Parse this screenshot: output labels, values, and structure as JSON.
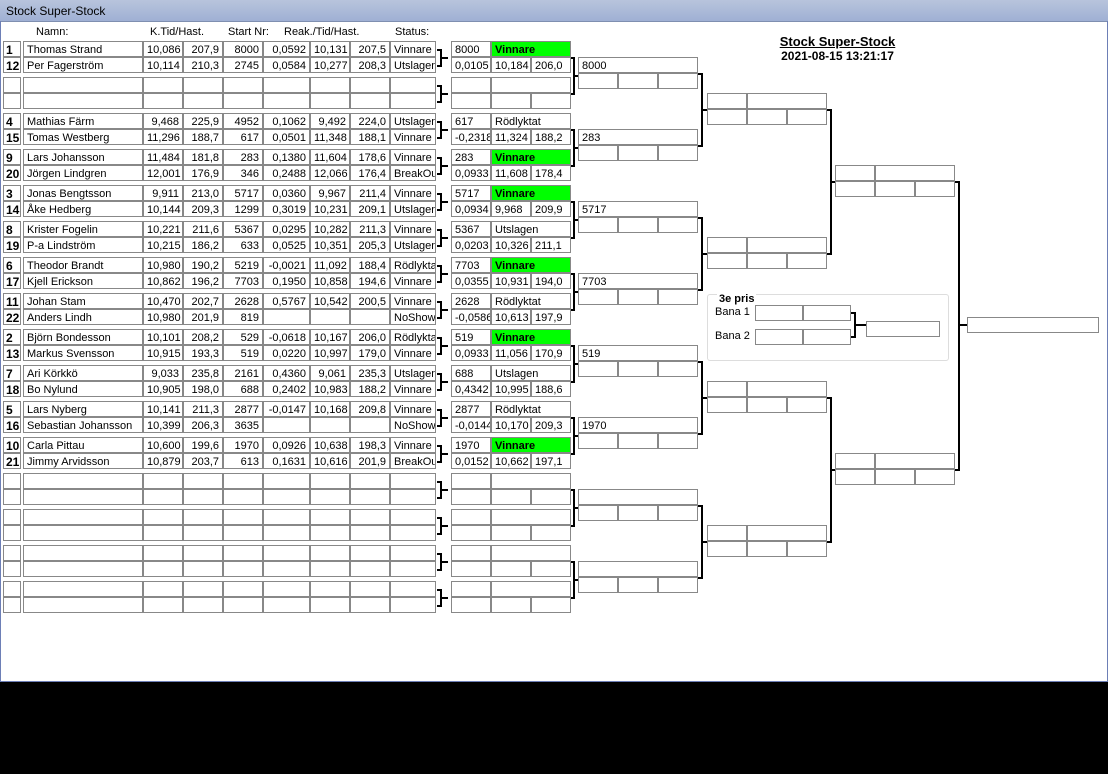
{
  "window_title": "Stock Super-Stock",
  "headers": {
    "name": "Namn:",
    "ktid": "K.Tid/Hast.",
    "start": "Start Nr:",
    "reak": "Reak./Tid/Hast.",
    "status": "Status:"
  },
  "title": "Stock Super-Stock",
  "datetime": "2021-08-15 13:21:17",
  "third_place": {
    "title": "3e pris",
    "lane1": "Bana 1",
    "lane2": "Bana 2"
  },
  "rows": [
    {
      "seed": "1",
      "name": "Thomas Strand",
      "ktid": "10,086",
      "hast": "207,9",
      "start": "8000",
      "reak": "0,0592",
      "tid": "10,131",
      "hast2": "207,5",
      "status": "Vinnare"
    },
    {
      "seed": "12",
      "name": "Per  Fagerström",
      "ktid": "10,114",
      "hast": "210,3",
      "start": "2745",
      "reak": "0,0584",
      "tid": "10,277",
      "hast2": "208,3",
      "status": "Utslagen"
    },
    {
      "seed": "",
      "name": "",
      "ktid": "",
      "hast": "",
      "start": "",
      "reak": "",
      "tid": "",
      "hast2": "",
      "status": ""
    },
    {
      "seed": "",
      "name": "",
      "ktid": "",
      "hast": "",
      "start": "",
      "reak": "",
      "tid": "",
      "hast2": "",
      "status": ""
    },
    {
      "seed": "4",
      "name": "Mathias Färm",
      "ktid": "9,468",
      "hast": "225,9",
      "start": "4952",
      "reak": "0,1062",
      "tid": "9,492",
      "hast2": "224,0",
      "status": "Utslagen"
    },
    {
      "seed": "15",
      "name": "Tomas Westberg",
      "ktid": "11,296",
      "hast": "188,7",
      "start": "617",
      "reak": "0,0501",
      "tid": "11,348",
      "hast2": "188,1",
      "status": "Vinnare"
    },
    {
      "seed": "9",
      "name": "Lars Johansson",
      "ktid": "11,484",
      "hast": "181,8",
      "start": "283",
      "reak": "0,1380",
      "tid": "11,604",
      "hast2": "178,6",
      "status": "Vinnare"
    },
    {
      "seed": "20",
      "name": "Jörgen Lindgren",
      "ktid": "12,001",
      "hast": "176,9",
      "start": "346",
      "reak": "0,2488",
      "tid": "12,066",
      "hast2": "176,4",
      "status": "BreakOut"
    },
    {
      "seed": "3",
      "name": "Jonas Bengtsson",
      "ktid": "9,911",
      "hast": "213,0",
      "start": "5717",
      "reak": "0,0360",
      "tid": "9,967",
      "hast2": "211,4",
      "status": "Vinnare"
    },
    {
      "seed": "14",
      "name": "Åke Hedberg",
      "ktid": "10,144",
      "hast": "209,3",
      "start": "1299",
      "reak": "0,3019",
      "tid": "10,231",
      "hast2": "209,1",
      "status": "Utslagen"
    },
    {
      "seed": "8",
      "name": "Krister Fogelin",
      "ktid": "10,221",
      "hast": "211,6",
      "start": "5367",
      "reak": "0,0295",
      "tid": "10,282",
      "hast2": "211,3",
      "status": "Vinnare"
    },
    {
      "seed": "19",
      "name": "P-a Lindström",
      "ktid": "10,215",
      "hast": "186,2",
      "start": "633",
      "reak": "0,0525",
      "tid": "10,351",
      "hast2": "205,3",
      "status": "Utslagen"
    },
    {
      "seed": "6",
      "name": "Theodor Brandt",
      "ktid": "10,980",
      "hast": "190,2",
      "start": "5219",
      "reak": "-0,0021",
      "tid": "11,092",
      "hast2": "188,4",
      "status": "Rödlyktat"
    },
    {
      "seed": "17",
      "name": "Kjell Erickson",
      "ktid": "10,862",
      "hast": "196,2",
      "start": "7703",
      "reak": "0,1950",
      "tid": "10,858",
      "hast2": "194,6",
      "status": "Vinnare"
    },
    {
      "seed": "11",
      "name": "Johan Stam",
      "ktid": "10,470",
      "hast": "202,7",
      "start": "2628",
      "reak": "0,5767",
      "tid": "10,542",
      "hast2": "200,5",
      "status": "Vinnare"
    },
    {
      "seed": "22",
      "name": "Anders Lindh",
      "ktid": "10,980",
      "hast": "201,9",
      "start": "819",
      "reak": "",
      "tid": "",
      "hast2": "",
      "status": "NoShow"
    },
    {
      "seed": "2",
      "name": "Björn Bondesson",
      "ktid": "10,101",
      "hast": "208,2",
      "start": "529",
      "reak": "-0,0618",
      "tid": "10,167",
      "hast2": "206,0",
      "status": "Rödlyktat"
    },
    {
      "seed": "13",
      "name": "Markus Svensson",
      "ktid": "10,915",
      "hast": "193,3",
      "start": "519",
      "reak": "0,0220",
      "tid": "10,997",
      "hast2": "179,0",
      "status": "Vinnare"
    },
    {
      "seed": "7",
      "name": "Ari Körkkö",
      "ktid": "9,033",
      "hast": "235,8",
      "start": "2161",
      "reak": "0,4360",
      "tid": "9,061",
      "hast2": "235,3",
      "status": "Utslagen"
    },
    {
      "seed": "18",
      "name": "Bo Nylund",
      "ktid": "10,905",
      "hast": "198,0",
      "start": "688",
      "reak": "0,2402",
      "tid": "10,983",
      "hast2": "188,2",
      "status": "Vinnare"
    },
    {
      "seed": "5",
      "name": "Lars Nyberg",
      "ktid": "10,141",
      "hast": "211,3",
      "start": "2877",
      "reak": "-0,0147",
      "tid": "10,168",
      "hast2": "209,8",
      "status": "Vinnare"
    },
    {
      "seed": "16",
      "name": "Sebastian Johansson",
      "ktid": "10,399",
      "hast": "206,3",
      "start": "3635",
      "reak": "",
      "tid": "",
      "hast2": "",
      "status": "NoShow"
    },
    {
      "seed": "10",
      "name": "Carla Pittau",
      "ktid": "10,600",
      "hast": "199,6",
      "start": "1970",
      "reak": "0,0926",
      "tid": "10,638",
      "hast2": "198,3",
      "status": "Vinnare"
    },
    {
      "seed": "21",
      "name": "Jimmy Arvidsson",
      "ktid": "10,879",
      "hast": "203,7",
      "start": "613",
      "reak": "0,1631",
      "tid": "10,616",
      "hast2": "201,9",
      "status": "BreakOut"
    }
  ],
  "round2": [
    {
      "a": "8000",
      "b": "Vinnare",
      "c": "",
      "d": "0,0105",
      "e": "10,184",
      "f": "206,0",
      "win": true
    },
    {
      "a": "",
      "b": "",
      "c": "",
      "d": "",
      "e": "",
      "f": "",
      "win": false
    },
    {
      "a": "617",
      "b": "Rödlyktat",
      "c": "",
      "d": "-0,2318",
      "e": "11,324",
      "f": "188,2",
      "win": false
    },
    {
      "a": "283",
      "b": "Vinnare",
      "c": "",
      "d": "0,0933",
      "e": "11,608",
      "f": "178,4",
      "win": true
    },
    {
      "a": "5717",
      "b": "Vinnare",
      "c": "",
      "d": "0,0934",
      "e": "9,968",
      "f": "209,9",
      "win": true
    },
    {
      "a": "5367",
      "b": "Utslagen",
      "c": "",
      "d": "0,0203",
      "e": "10,326",
      "f": "211,1",
      "win": false
    },
    {
      "a": "7703",
      "b": "Vinnare",
      "c": "",
      "d": "0,0355",
      "e": "10,931",
      "f": "194,0",
      "win": true
    },
    {
      "a": "2628",
      "b": "Rödlyktat",
      "c": "",
      "d": "-0,0586",
      "e": "10,613",
      "f": "197,9",
      "win": false
    },
    {
      "a": "519",
      "b": "Vinnare",
      "c": "",
      "d": "0,0933",
      "e": "11,056",
      "f": "170,9",
      "win": true
    },
    {
      "a": "688",
      "b": "Utslagen",
      "c": "",
      "d": "0,4342",
      "e": "10,995",
      "f": "188,6",
      "win": false
    },
    {
      "a": "2877",
      "b": "Rödlyktat",
      "c": "",
      "d": "-0,0144",
      "e": "10,170",
      "f": "209,3",
      "win": false
    },
    {
      "a": "1970",
      "b": "Vinnare",
      "c": "",
      "d": "0,0152",
      "e": "10,662",
      "f": "197,1",
      "win": true
    },
    {
      "a": "",
      "b": "",
      "c": "",
      "d": "",
      "e": "",
      "f": "",
      "win": false
    },
    {
      "a": "",
      "b": "",
      "c": "",
      "d": "",
      "e": "",
      "f": "",
      "win": false
    },
    {
      "a": "",
      "b": "",
      "c": "",
      "d": "",
      "e": "",
      "f": "",
      "win": false
    },
    {
      "a": "",
      "b": "",
      "c": "",
      "d": "",
      "e": "",
      "f": "",
      "win": false
    }
  ],
  "round3": [
    "8000",
    "283",
    "5717",
    "7703",
    "519",
    "1970",
    "",
    ""
  ]
}
